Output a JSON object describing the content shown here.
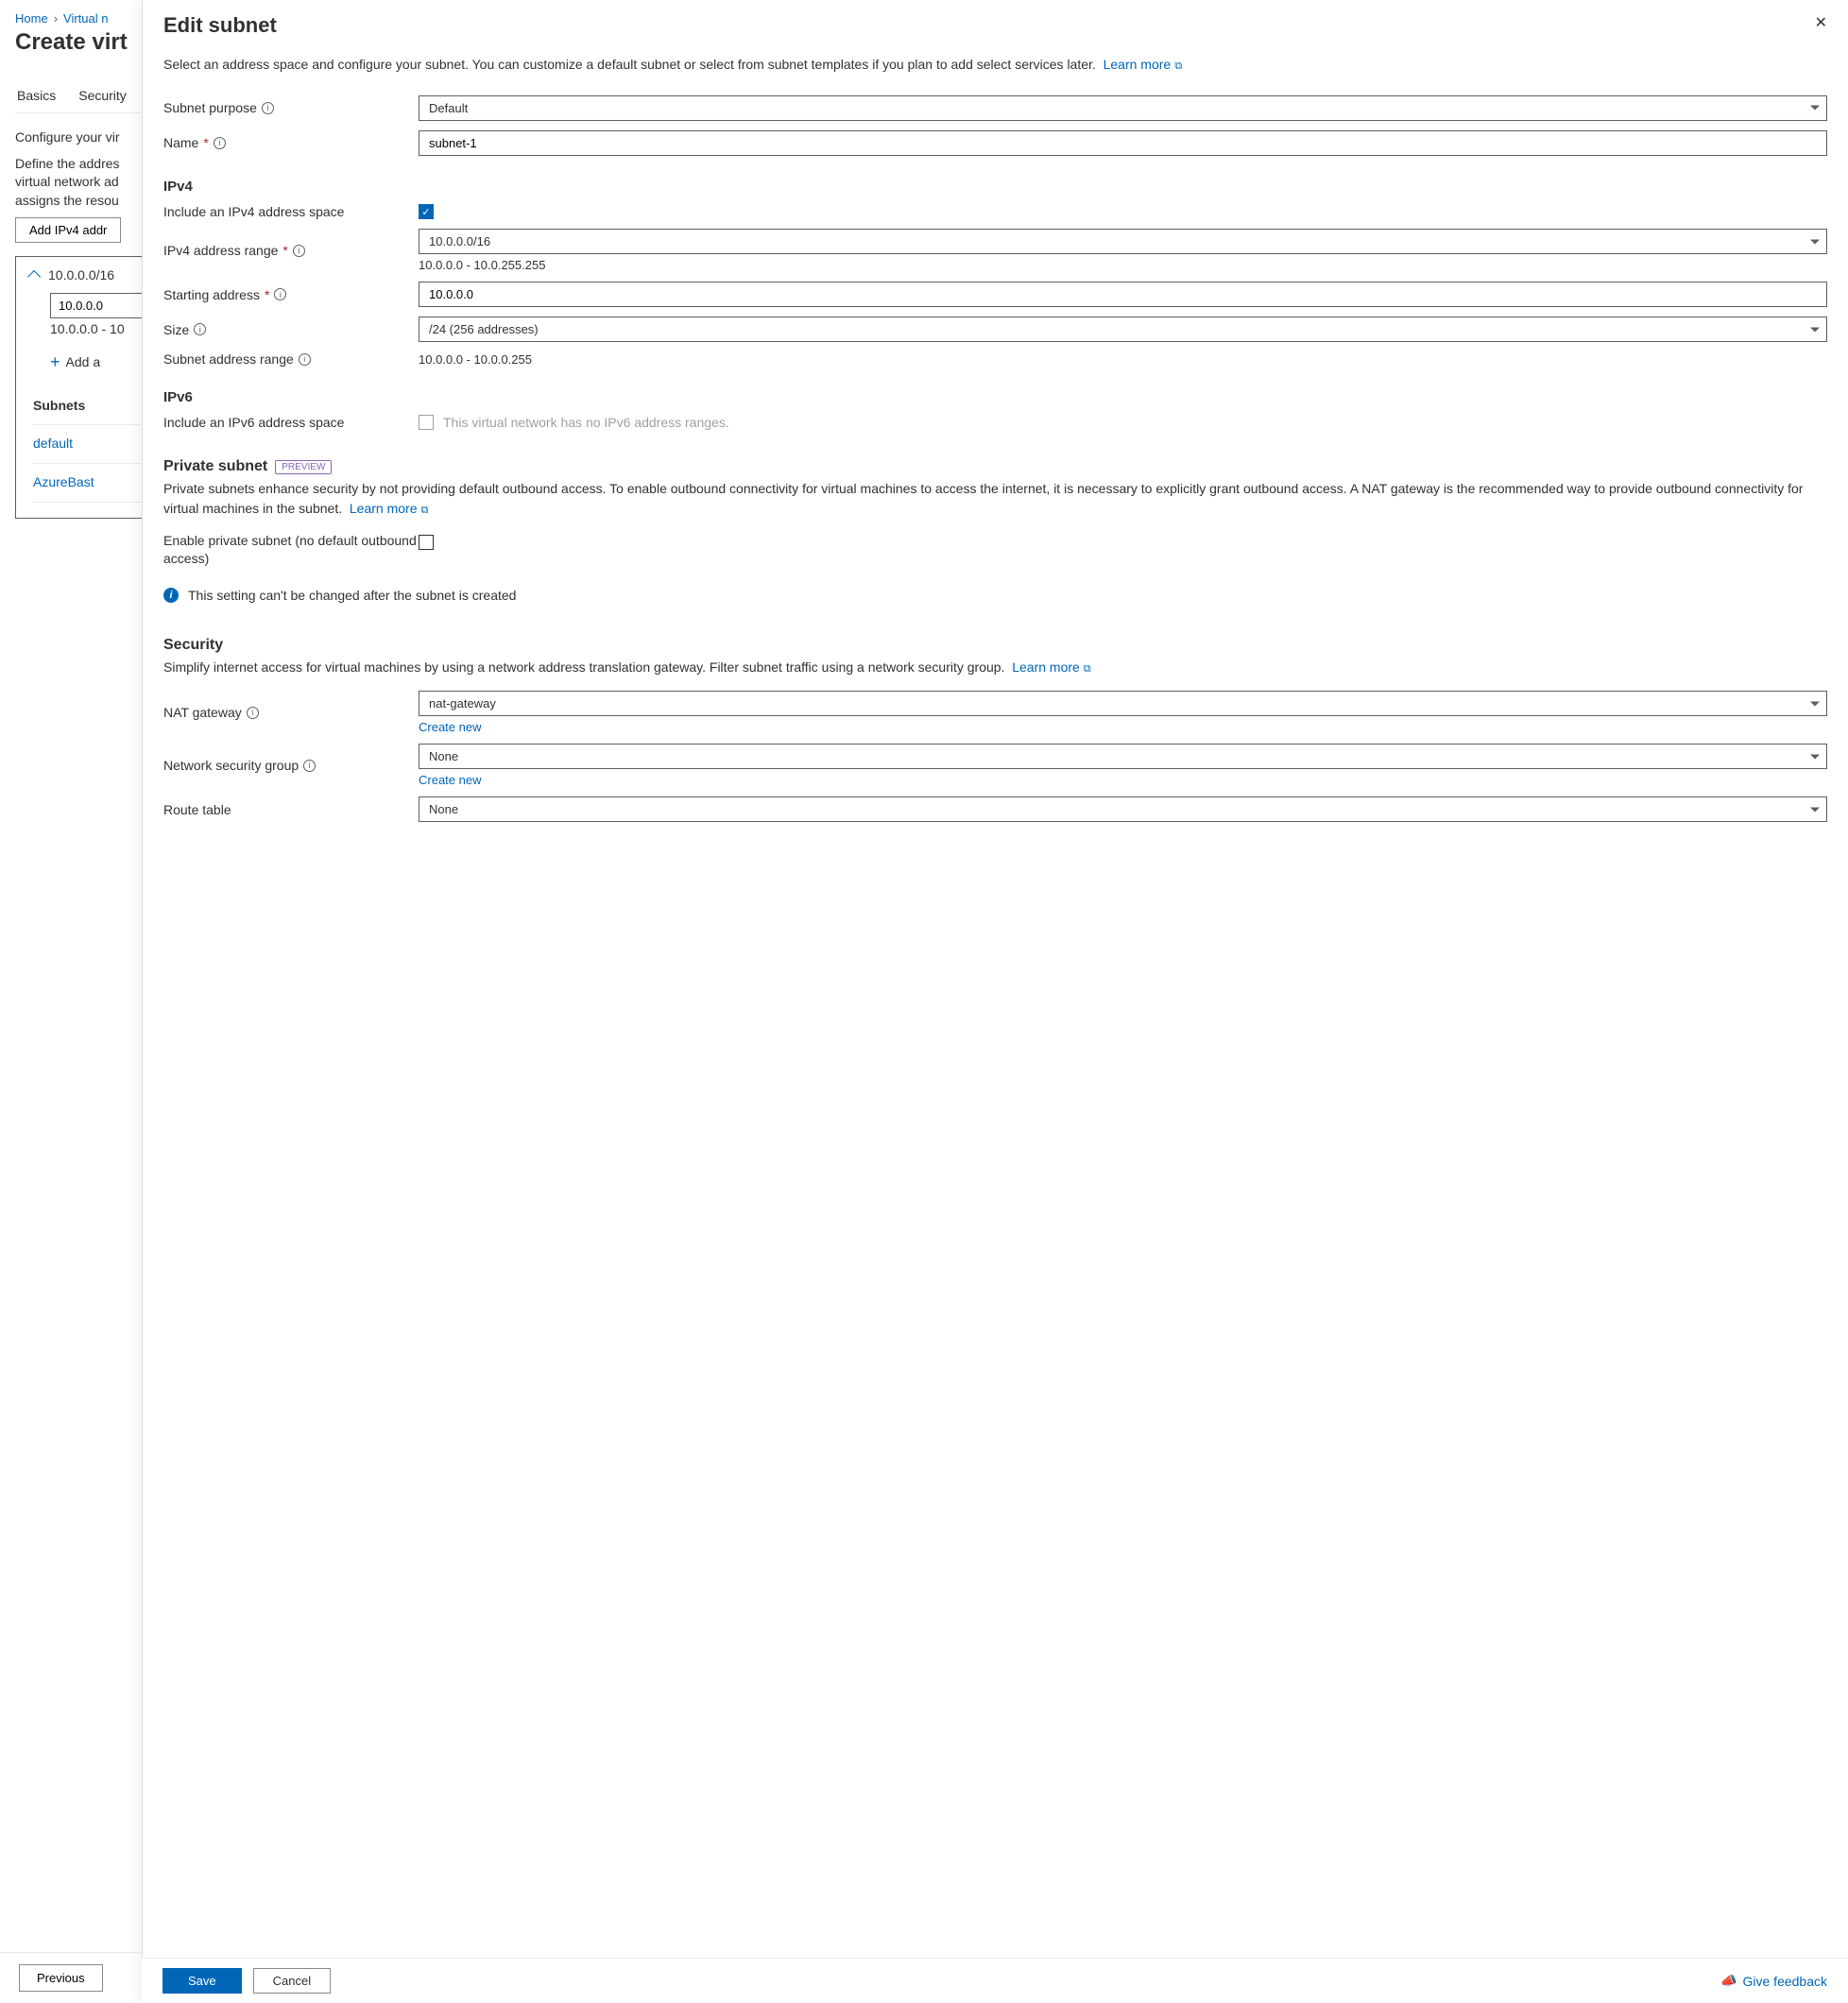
{
  "background": {
    "breadcrumb": {
      "home": "Home",
      "item1": "Virtual n"
    },
    "page_title": "Create virt",
    "tabs": [
      "Basics",
      "Security"
    ],
    "config_text": "Configure your vir",
    "define_text": "Define the addres virtual network ad assigns the resou",
    "add_button": "Add IPv4 addr",
    "addr_space": {
      "cidr": "10.0.0.0/16",
      "start": "10.0.0.0",
      "range": "10.0.0.0 - 10",
      "add_link": "Add a"
    },
    "subnets_header": "Subnets",
    "subnets": [
      "default",
      "AzureBast"
    ],
    "prev_button": "Previous"
  },
  "panel": {
    "title": "Edit subnet",
    "description": "Select an address space and configure your subnet. You can customize a default subnet or select from subnet templates if you plan to add select services later.",
    "learn_more": "Learn more",
    "fields": {
      "purpose_label": "Subnet purpose",
      "purpose_value": "Default",
      "name_label": "Name",
      "name_value": "subnet-1"
    },
    "ipv4": {
      "heading": "IPv4",
      "include_label": "Include an IPv4 address space",
      "include_checked": true,
      "range_label": "IPv4 address range",
      "range_value": "10.0.0.0/16",
      "range_hint": "10.0.0.0 - 10.0.255.255",
      "starting_label": "Starting address",
      "starting_value": "10.0.0.0",
      "size_label": "Size",
      "size_value": "/24 (256 addresses)",
      "subnet_range_label": "Subnet address range",
      "subnet_range_value": "10.0.0.0 - 10.0.0.255"
    },
    "ipv6": {
      "heading": "IPv6",
      "include_label": "Include an IPv6 address space",
      "disabled_text": "This virtual network has no IPv6 address ranges."
    },
    "private": {
      "heading": "Private subnet",
      "preview": "PREVIEW",
      "desc": "Private subnets enhance security by not providing default outbound access. To enable outbound connectivity for virtual machines to access the internet, it is necessary to explicitly grant outbound access. A NAT gateway is the recommended way to provide outbound connectivity for virtual machines in the subnet.",
      "enable_label": "Enable private subnet (no default outbound access)",
      "warning": "This setting can't be changed after the subnet is created"
    },
    "security": {
      "heading": "Security",
      "desc": "Simplify internet access for virtual machines by using a network address translation gateway. Filter subnet traffic using a network security group.",
      "nat_label": "NAT gateway",
      "nat_value": "nat-gateway",
      "nsg_label": "Network security group",
      "nsg_value": "None",
      "route_label": "Route table",
      "route_value": "None",
      "create_new": "Create new"
    },
    "footer": {
      "save": "Save",
      "cancel": "Cancel",
      "feedback": "Give feedback"
    }
  }
}
